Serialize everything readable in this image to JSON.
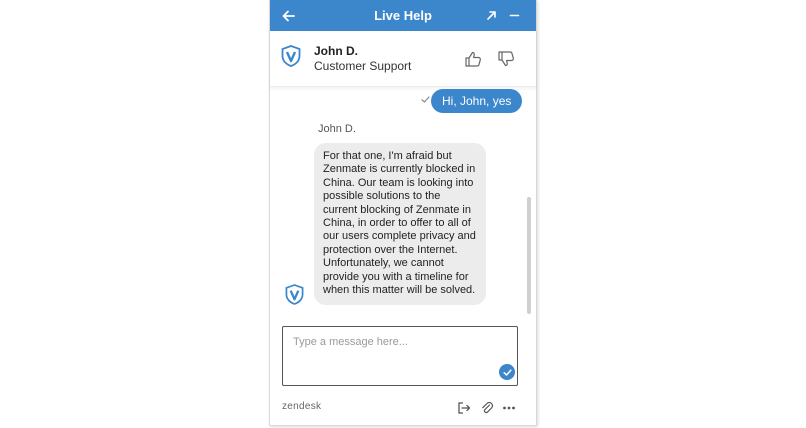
{
  "header": {
    "title": "Live Help",
    "icons": [
      "arrow-left-icon",
      "popout-arrow-icon",
      "minimize-icon"
    ]
  },
  "agent": {
    "name": "John D.",
    "role": "Customer Support",
    "logo": "shield-v-logo"
  },
  "messages": [
    {
      "sender": "visitor",
      "text": "Hi, John, yes",
      "status": "check-icon"
    },
    {
      "sender": "agent",
      "name": "John D.",
      "text": "For that one, I'm afraid but Zenmate is currently blocked in China. Our team is looking into possible solutions to the current blocking of Zenmate in China, in order to offer to all of our users complete privacy and protection over the Internet. Unfortunately, we cannot provide you with a timeline for when this matter will be solved."
    }
  ],
  "input": {
    "placeholder": "Type a message here...",
    "value": ""
  },
  "footer": {
    "brand": "zendesk",
    "icons": [
      "transcript-exit-icon",
      "paperclip-icon",
      "more-icon"
    ]
  },
  "colors": {
    "accent": "#3c86cb",
    "bubble_agent": "#ececec",
    "logo": "#3c86cb"
  }
}
